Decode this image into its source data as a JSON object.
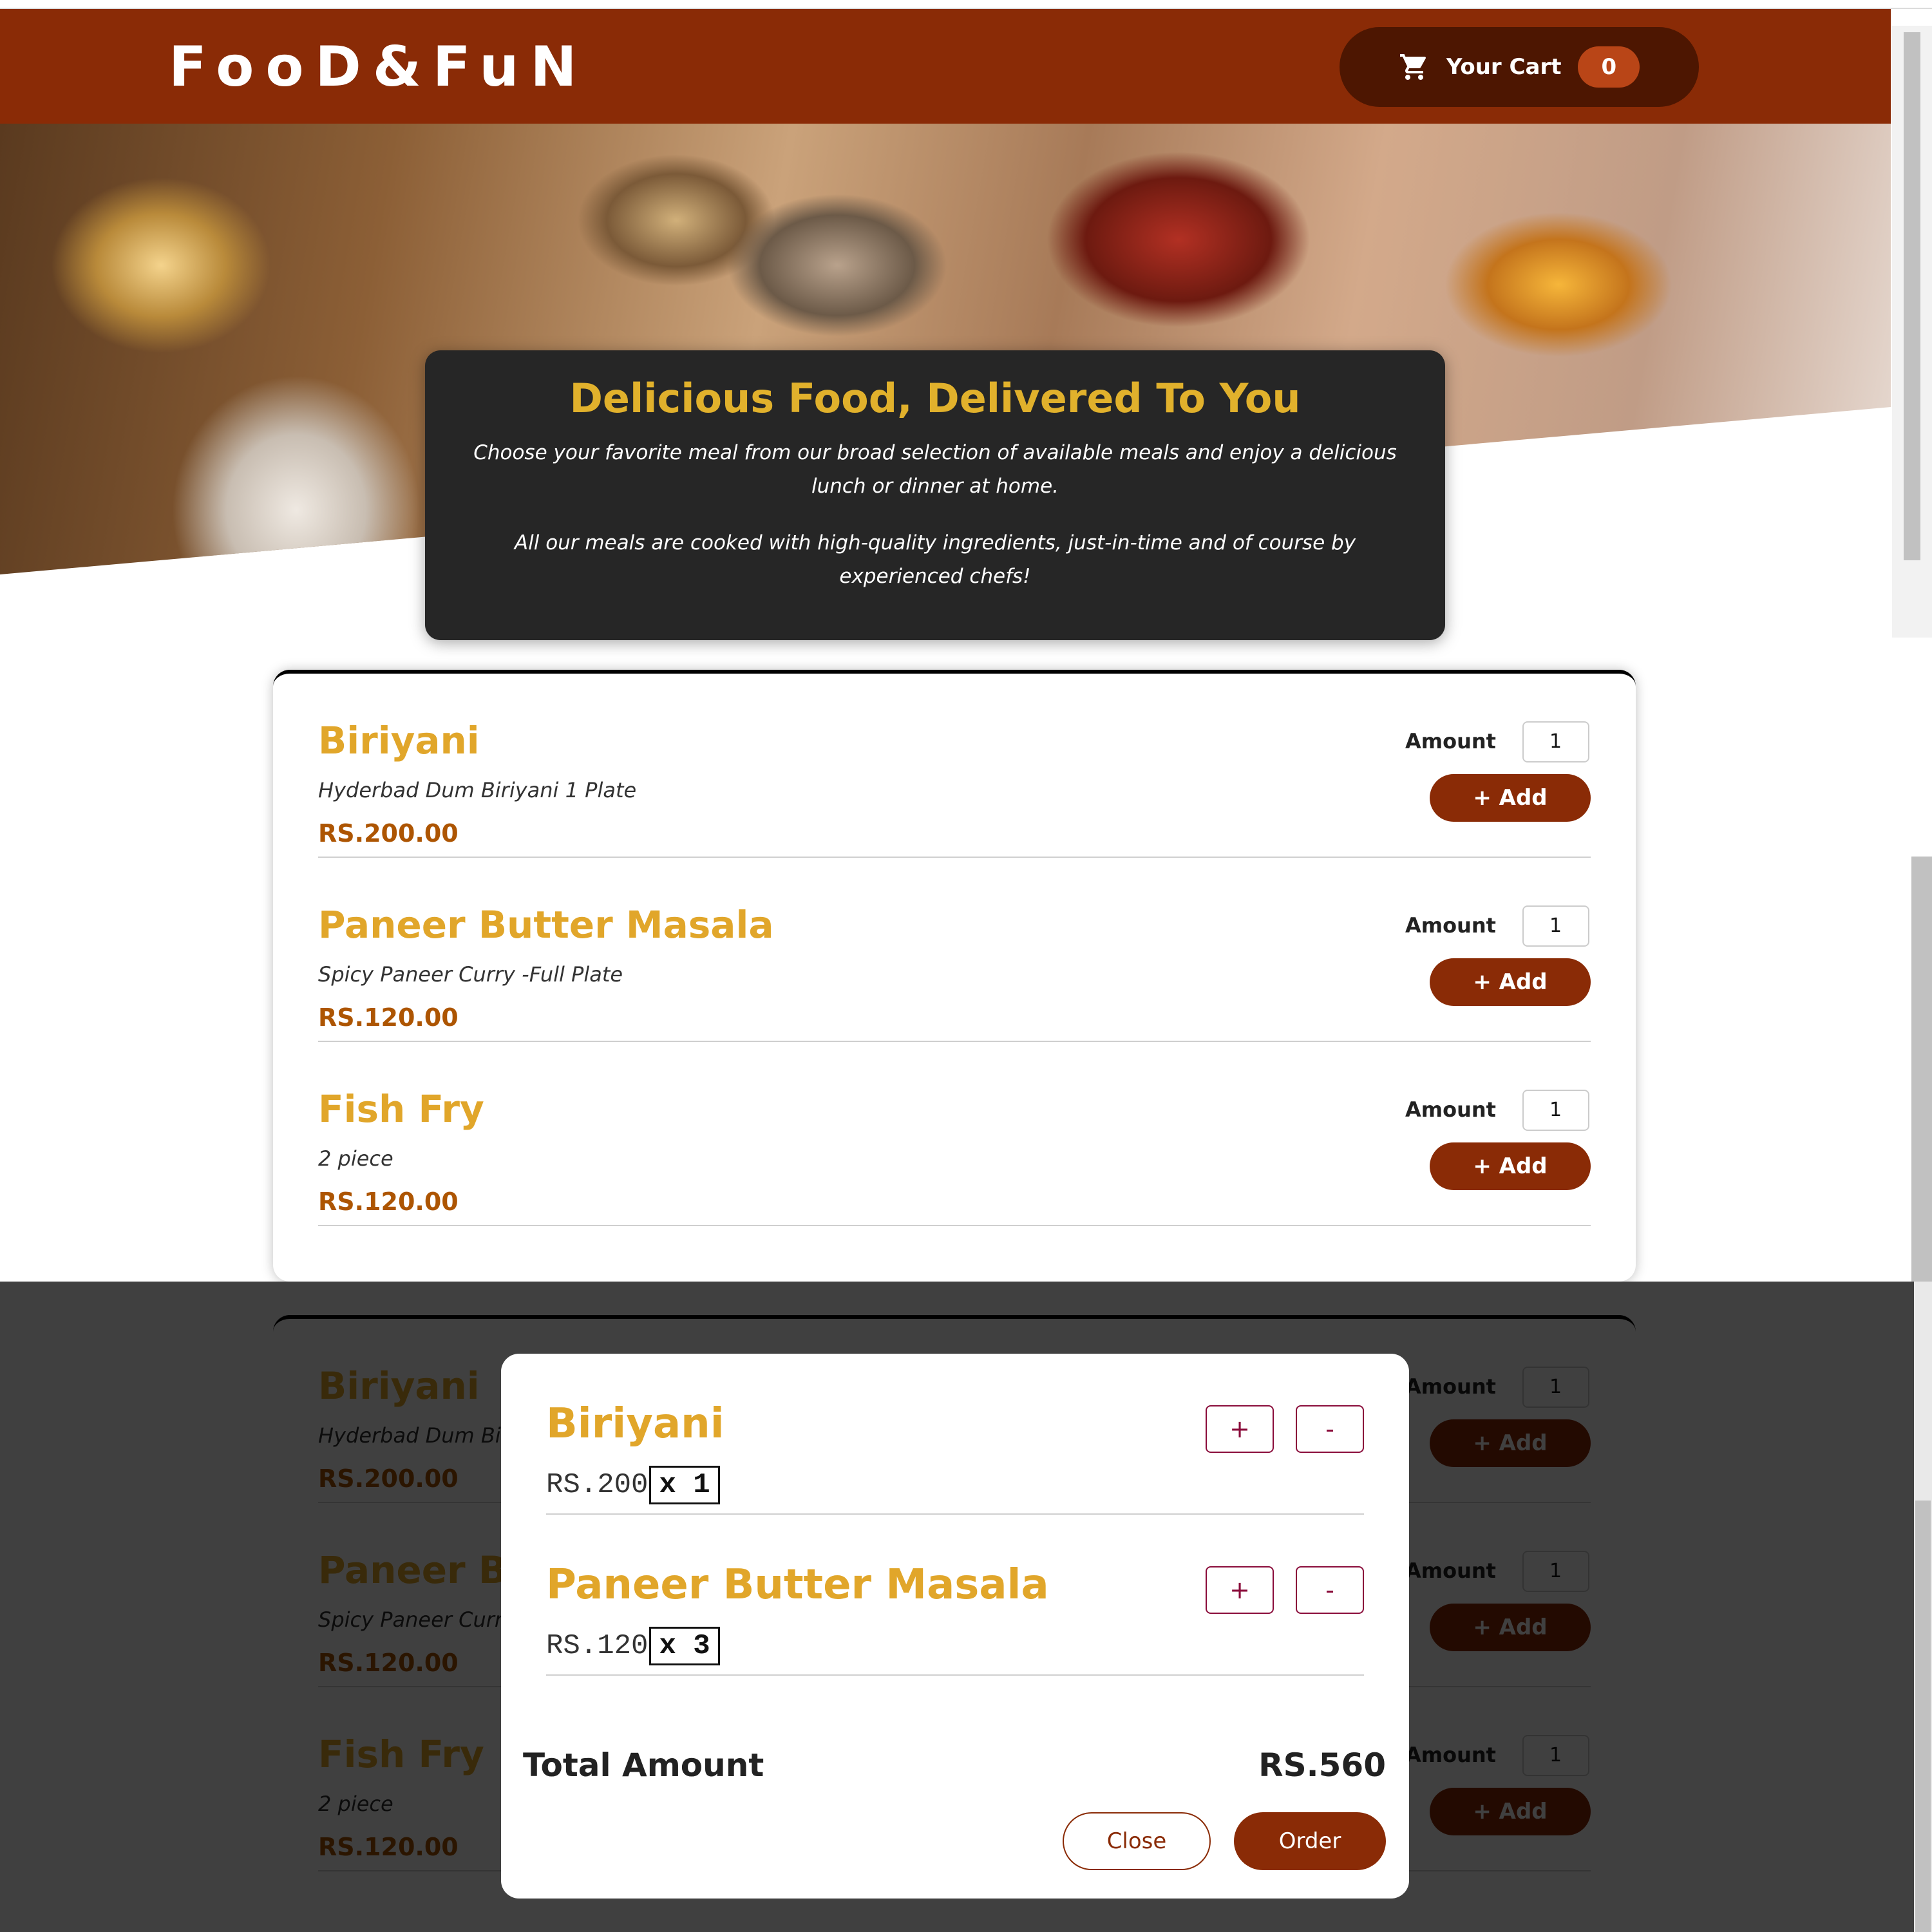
{
  "header": {
    "logo": "FooD&FuN",
    "cart_label": "Your Cart",
    "cart_count": "0",
    "cart_icon": "cart-icon"
  },
  "hero": {
    "title": "Delicious Food, Delivered To You",
    "text1": "Choose your favorite meal from our broad selection of available meals and enjoy a delicious lunch or dinner at home.",
    "text2": "All our meals are cooked with high-quality ingredients, just-in-time and of course by experienced chefs!"
  },
  "meals": [
    {
      "name": "Biriyani",
      "description": "Hyderbad Dum Biriyani 1 Plate",
      "price": "RS.200.00",
      "amount_label": "Amount",
      "amount": "1",
      "add_label": "+ Add"
    },
    {
      "name": "Paneer Butter Masala",
      "description": "Spicy Paneer Curry -Full Plate",
      "price": "RS.120.00",
      "amount_label": "Amount",
      "amount": "1",
      "add_label": "+ Add"
    },
    {
      "name": "Fish Fry",
      "description": "2 piece",
      "price": "RS.120.00",
      "amount_label": "Amount",
      "amount": "1",
      "add_label": "+ Add"
    }
  ],
  "cart_modal": {
    "items": [
      {
        "name": "Biriyani",
        "price": "RS.200",
        "qty": "x 1",
        "plus": "+",
        "minus": "-"
      },
      {
        "name": "Paneer Butter Masala",
        "price": "RS.120",
        "qty": "x 3",
        "plus": "+",
        "minus": "-"
      }
    ],
    "total_label": "Total Amount",
    "total_value": "RS.560",
    "close_label": "Close",
    "order_label": "Order"
  },
  "colors": {
    "brand": "#8a2b06",
    "accent": "#e1a62a",
    "price": "#ad5502"
  }
}
